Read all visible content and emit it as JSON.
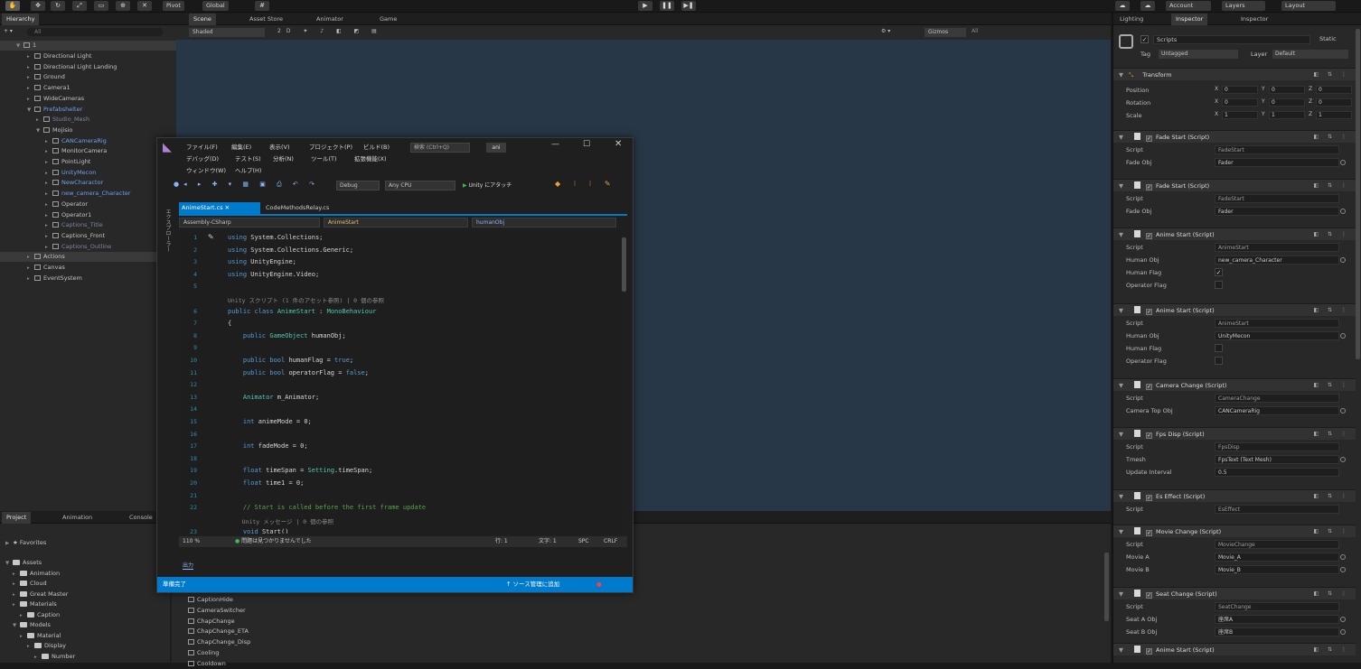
{
  "topbar": {
    "play_labels": [
      "Pivot",
      "Global"
    ],
    "account": "Account",
    "layers": "Layers",
    "layout": "Layout"
  },
  "hierarchy": {
    "tab": "Hierarchy",
    "search_placeholder": "All",
    "scene_name": "1",
    "items": [
      {
        "label": "Directional Light",
        "depth": 2,
        "style": "normal"
      },
      {
        "label": "Directional Light Landing",
        "depth": 2,
        "style": "normal"
      },
      {
        "label": "Ground",
        "depth": 2,
        "style": "normal"
      },
      {
        "label": "Camera1",
        "depth": 2,
        "style": "normal"
      },
      {
        "label": "WideCameras",
        "depth": 2,
        "style": "normal"
      },
      {
        "label": "Prefabshelter",
        "depth": 2,
        "style": "blue"
      },
      {
        "label": "Studio_Mesh",
        "depth": 3,
        "style": "dim"
      },
      {
        "label": "Mojisio",
        "depth": 3,
        "style": "normal"
      },
      {
        "label": "CANCameraRig",
        "depth": 4,
        "style": "blue"
      },
      {
        "label": "MonitorCamera",
        "depth": 4,
        "style": "normal"
      },
      {
        "label": "PointLight",
        "depth": 4,
        "style": "normal"
      },
      {
        "label": "UnityMecon",
        "depth": 4,
        "style": "blue"
      },
      {
        "label": "NewCharactor",
        "depth": 4,
        "style": "blue"
      },
      {
        "label": "new_camera_Character",
        "depth": 4,
        "style": "blue"
      },
      {
        "label": "Operator",
        "depth": 4,
        "style": "normal"
      },
      {
        "label": "Operator1",
        "depth": 4,
        "style": "normal"
      },
      {
        "label": "Captions_Title",
        "depth": 4,
        "style": "dim"
      },
      {
        "label": "Captions_Front",
        "depth": 4,
        "style": "normal"
      },
      {
        "label": "Captions_Outline",
        "depth": 4,
        "style": "dim"
      },
      {
        "label": "Actions",
        "depth": 2,
        "style": "hl"
      },
      {
        "label": "Canvas",
        "depth": 2,
        "style": "normal"
      },
      {
        "label": "EventSystem",
        "depth": 2,
        "style": "normal"
      }
    ]
  },
  "scene": {
    "tabs": [
      "Scene",
      "Asset Store",
      "Animator",
      "Game"
    ],
    "shading": "Shaded",
    "gizmos": "Gizmos",
    "search_placeholder": "All"
  },
  "project": {
    "tabs": [
      "Project",
      "Animation",
      "Console"
    ],
    "favorites": "Favorites",
    "tree": [
      {
        "label": "Assets",
        "depth": 0
      },
      {
        "label": "Animation",
        "depth": 1
      },
      {
        "label": "Cloud",
        "depth": 1
      },
      {
        "label": "Great Master",
        "depth": 1
      },
      {
        "label": "Materials",
        "depth": 1
      },
      {
        "label": "Caption",
        "depth": 2
      },
      {
        "label": "Models",
        "depth": 1
      },
      {
        "label": "Material",
        "depth": 2
      },
      {
        "label": "Display",
        "depth": 3
      },
      {
        "label": "Number",
        "depth": 4
      }
    ],
    "files": [
      "CaptionHide",
      "CameraSwitcher",
      "ChapChange",
      "ChapChange_ETA",
      "ChapChange_Disp",
      "Cooling",
      "Cooldown"
    ]
  },
  "vs": {
    "menu_row1": [
      "ファイル(F)",
      "編集(E)",
      "表示(V)",
      "プロジェクト(P)",
      "ビルド(B)"
    ],
    "menu_row2": [
      "デバッグ(D)",
      "テスト(S)",
      "分析(N)",
      "ツール(T)",
      "拡張機能(X)"
    ],
    "menu_row3": [
      "ウィンドウ(W)",
      "ヘルプ(H)"
    ],
    "search_box": "検索 (Ctrl+Q)",
    "solution_badge": "ani",
    "config": "Debug",
    "platform": "Any CPU",
    "attach": "Unity にアタッチ",
    "side_label": "エクスプローラー",
    "doc_tabs": [
      "AnimeStart.cs",
      "CodeMethodsRelay.cs"
    ],
    "nav_project": "Assembly-CSharp",
    "nav_class": "AnimeStart",
    "nav_member": "humanObj",
    "code_lines": [
      {
        "n": "1",
        "t": "using System.Collections;"
      },
      {
        "n": "2",
        "t": "using System.Collections.Generic;"
      },
      {
        "n": "3",
        "t": "using UnityEngine;"
      },
      {
        "n": "4",
        "t": "using UnityEngine.Video;"
      },
      {
        "n": "5",
        "t": ""
      },
      {
        "n": "",
        "t": "Unity スクリプト (1 件のアセット参照) | 0 個の参照"
      },
      {
        "n": "6",
        "t": "public class AnimeStart : MonoBehaviour"
      },
      {
        "n": "7",
        "t": "{"
      },
      {
        "n": "8",
        "t": "    public GameObject humanObj;"
      },
      {
        "n": "9",
        "t": ""
      },
      {
        "n": "10",
        "t": "    public bool humanFlag = true;"
      },
      {
        "n": "11",
        "t": "    public bool operatorFlag = false;"
      },
      {
        "n": "12",
        "t": ""
      },
      {
        "n": "13",
        "t": "    Animator m_Animator;"
      },
      {
        "n": "14",
        "t": ""
      },
      {
        "n": "15",
        "t": "    int animeMode = 0;"
      },
      {
        "n": "16",
        "t": ""
      },
      {
        "n": "17",
        "t": "    int fadeMode = 0;"
      },
      {
        "n": "18",
        "t": ""
      },
      {
        "n": "19",
        "t": "    float timeSpan = Setting.timeSpan;"
      },
      {
        "n": "20",
        "t": "    float time1 = 0;"
      },
      {
        "n": "21",
        "t": ""
      },
      {
        "n": "22",
        "t": "    // Start is called before the first frame update"
      },
      {
        "n": "",
        "t": "    Unity メッセージ | 0 個の参照"
      },
      {
        "n": "23",
        "t": "    void Start()"
      }
    ],
    "status_zoom": "110 %",
    "status_issues": "問題は見つかりませんでした",
    "status_pos": "行: 1",
    "status_char": "文字: 1",
    "status_spc": "SPC",
    "status_crlf": "CRLF",
    "output_label": "出力",
    "ready": "準備完了",
    "source_control": "ソース管理に追加"
  },
  "inspector": {
    "tabs": [
      "Lighting",
      "Inspector",
      "Inspector"
    ],
    "object_name": "Scripts",
    "static_label": "Static",
    "tag_label": "Tag",
    "tag_value": "Untagged",
    "layer_label": "Layer",
    "layer_value": "Default",
    "transform": {
      "title": "Transform",
      "rows": [
        {
          "label": "Position",
          "x": "0",
          "y": "0",
          "z": "0"
        },
        {
          "label": "Rotation",
          "x": "0",
          "y": "0",
          "z": "0"
        },
        {
          "label": "Scale",
          "x": "1",
          "y": "1",
          "z": "1"
        }
      ]
    },
    "components": [
      {
        "title": "Fade Start (Script)",
        "props": [
          {
            "l": "Script",
            "v": "FadeStart",
            "kind": "script"
          },
          {
            "l": "Fade Obj",
            "v": "Fader",
            "kind": "obj"
          }
        ]
      },
      {
        "title": "Fade Start (Script)",
        "props": [
          {
            "l": "Script",
            "v": "FadeStart",
            "kind": "script"
          },
          {
            "l": "Fade Obj",
            "v": "Fader",
            "kind": "obj"
          }
        ]
      },
      {
        "title": "Anime Start (Script)",
        "props": [
          {
            "l": "Script",
            "v": "AnimeStart",
            "kind": "script"
          },
          {
            "l": "Human Obj",
            "v": "new_camera_Character",
            "kind": "obj"
          },
          {
            "l": "Human Flag",
            "v": "✓",
            "kind": "check"
          },
          {
            "l": "Operator Flag",
            "v": "",
            "kind": "check"
          }
        ]
      },
      {
        "title": "Anime Start (Script)",
        "props": [
          {
            "l": "Script",
            "v": "AnimeStart",
            "kind": "script"
          },
          {
            "l": "Human Obj",
            "v": "UnityMecon",
            "kind": "obj"
          },
          {
            "l": "Human Flag",
            "v": "",
            "kind": "check"
          },
          {
            "l": "Operator Flag",
            "v": "",
            "kind": "check"
          }
        ]
      },
      {
        "title": "Camera Change (Script)",
        "props": [
          {
            "l": "Script",
            "v": "CameraChange",
            "kind": "script"
          },
          {
            "l": "Camera Top Obj",
            "v": "CANCameraRig",
            "kind": "obj"
          }
        ]
      },
      {
        "title": "Fps Disp (Script)",
        "props": [
          {
            "l": "Script",
            "v": "FpsDisp",
            "kind": "script"
          },
          {
            "l": "Tmesh",
            "v": "FpsText (Text Mesh)",
            "kind": "obj"
          },
          {
            "l": "Update Interval",
            "v": "0.5",
            "kind": "num"
          }
        ]
      },
      {
        "title": "Es Effect (Script)",
        "props": [
          {
            "l": "Script",
            "v": "EsEffect",
            "kind": "script"
          }
        ]
      },
      {
        "title": "Movie Change (Script)",
        "props": [
          {
            "l": "Script",
            "v": "MovieChange",
            "kind": "script"
          },
          {
            "l": "Movie A",
            "v": "Movie_A",
            "kind": "obj"
          },
          {
            "l": "Movie B",
            "v": "Movie_B",
            "kind": "obj"
          }
        ]
      },
      {
        "title": "Seat Change (Script)",
        "props": [
          {
            "l": "Script",
            "v": "SeatChange",
            "kind": "script"
          },
          {
            "l": "Seat A Obj",
            "v": "座席A",
            "kind": "obj"
          },
          {
            "l": "Seat B Obj",
            "v": "座席B",
            "kind": "obj"
          }
        ]
      },
      {
        "title": "Anime Start (Script)",
        "props": []
      }
    ]
  }
}
